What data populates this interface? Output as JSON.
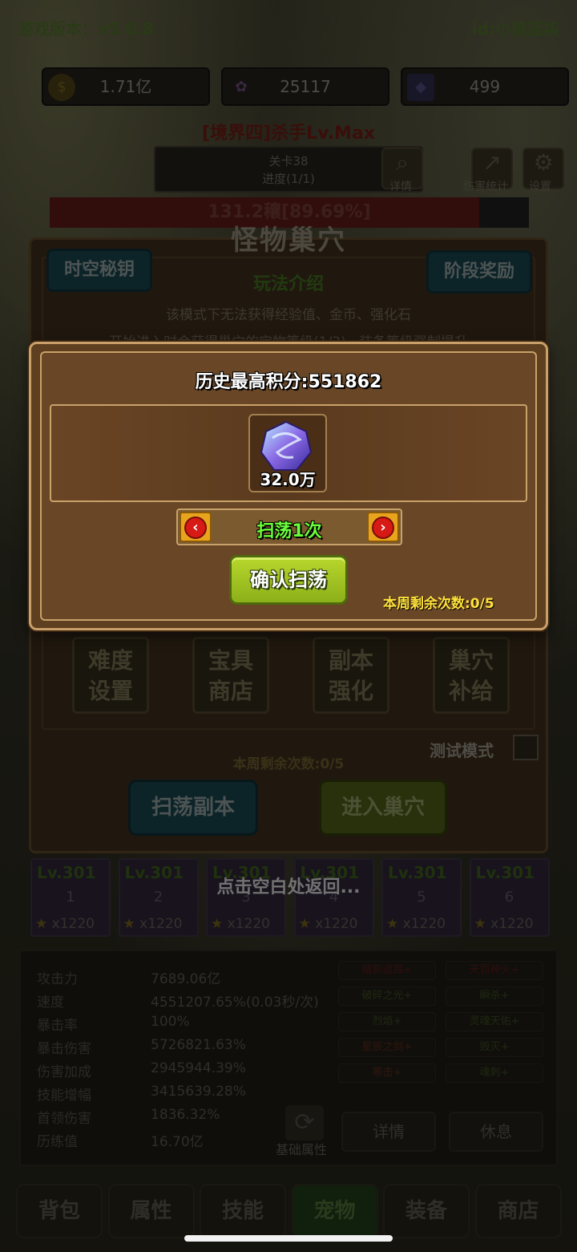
{
  "header": {
    "version": "游戏版本：v5.0.8",
    "user_id": "id:小狼蓝柒"
  },
  "resources": [
    {
      "icon": "coin-icon",
      "value": "1.71亿"
    },
    {
      "icon": "lotus-icon",
      "value": "25117"
    },
    {
      "icon": "card-icon",
      "value": "499"
    }
  ],
  "stage": {
    "title": "[境界四]杀手Lv.Max",
    "level": "关卡38",
    "progress": "进度(1/1)",
    "details_label": "详情",
    "damage_stats_label": "伤害统计",
    "settings_label": "设置",
    "hp_text": "131.2穰[89.69%]",
    "hp_fraction": 0.8969
  },
  "nest": {
    "title": "怪物巢穴",
    "spacetime_key_label": "时空秘钥",
    "stage_reward_label": "阶段奖励",
    "intro_title": "玩法介绍",
    "intro_line1": "该模式下无法获得经验值、金币、强化石",
    "intro_line2": "开始进入时会获得巢穴的宝物等级(1/3) · 装备等级强制提升",
    "grid_buttons": [
      {
        "line1": "难度",
        "line2": "设置"
      },
      {
        "line1": "宝具",
        "line2": "商店"
      },
      {
        "line1": "副本",
        "line2": "强化"
      },
      {
        "line1": "巢穴",
        "line2": "补给"
      }
    ],
    "test_mode_label": "测试模式",
    "weekly_remaining": "本周剩余次数:0/5",
    "sweep_button": "扫荡副本",
    "enter_button": "进入巢穴"
  },
  "dialog": {
    "high_score": "历史最高积分:551862",
    "reward_count": "32.0万",
    "sweep_times": "扫荡1次",
    "confirm_button": "确认扫荡",
    "weekly_remaining": "本周剩余次数:0/5"
  },
  "tap_return": "点击空白处返回...",
  "pets": [
    {
      "level": "Lv.301",
      "num": "1",
      "count": "x1220"
    },
    {
      "level": "Lv.301",
      "num": "2",
      "count": "x1220"
    },
    {
      "level": "Lv.301",
      "num": "3",
      "count": "x1220"
    },
    {
      "level": "Lv.301",
      "num": "4",
      "count": "x1220"
    },
    {
      "level": "Lv.301",
      "num": "5",
      "count": "x1220"
    },
    {
      "level": "Lv.301",
      "num": "6",
      "count": "x1220"
    }
  ],
  "stats": [
    {
      "label": "攻击力",
      "value": "7689.06亿"
    },
    {
      "label": "速度",
      "value": "4551207.65%(0.03秒/次)"
    },
    {
      "label": "暴击率",
      "value": "100%"
    },
    {
      "label": "暴击伤害",
      "value": "5726821.63%"
    },
    {
      "label": "伤害加成",
      "value": "2945944.39%"
    },
    {
      "label": "技能增幅",
      "value": "3415639.28%"
    },
    {
      "label": "首领伤害",
      "value": "1836.32%"
    },
    {
      "label": "历练值",
      "value": "16.70亿"
    }
  ],
  "skills": [
    "暗影追踪+",
    "天罚神火+",
    "破碎之光+",
    "瞬杀+",
    "烈焰+",
    "灵魂天佑+",
    "星辰之剑+",
    "毁灭+",
    "寒击+",
    "魂刺+"
  ],
  "base_attr_label": "基础属性",
  "details_button": "详情",
  "rest_button": "休息",
  "tabs": [
    "背包",
    "属性",
    "技能",
    "宠物",
    "装备",
    "商店"
  ]
}
